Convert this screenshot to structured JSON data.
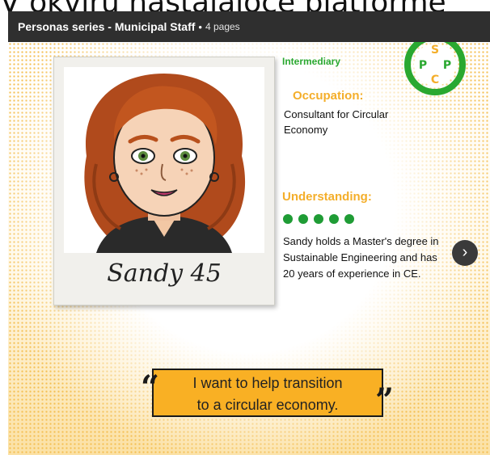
{
  "page_overflow_text": "V okviru nastajajoče platforme",
  "titlebar": {
    "series": "Personas series - Municipal Staff",
    "separator": "•",
    "pages": "4 pages"
  },
  "persona": {
    "level": "Intermediary",
    "signature": "Sandy 45",
    "occupation_label": "Occupation:",
    "occupation": "Consultant for Circular Economy",
    "understanding_label": "Understanding:",
    "understanding_rating": 5,
    "understanding_text": "Sandy holds a Master's degree in Sustainable Engineering and has 20 years of experience in CE.",
    "quote_line1": "I want to help transition",
    "quote_line2": "to a circular economy."
  },
  "logo": {
    "letters": [
      "S",
      "P",
      "P",
      "C"
    ]
  },
  "colors": {
    "accent": "#f4ae2a",
    "green": "#2aa830",
    "rating": "#1f9c35",
    "quote_bg": "#f9b024",
    "titlebar_bg": "#2f2f2f"
  },
  "icons": {
    "next": "chevron-right-icon",
    "quote_open": "open-quote-icon",
    "quote_close": "close-quote-icon"
  }
}
